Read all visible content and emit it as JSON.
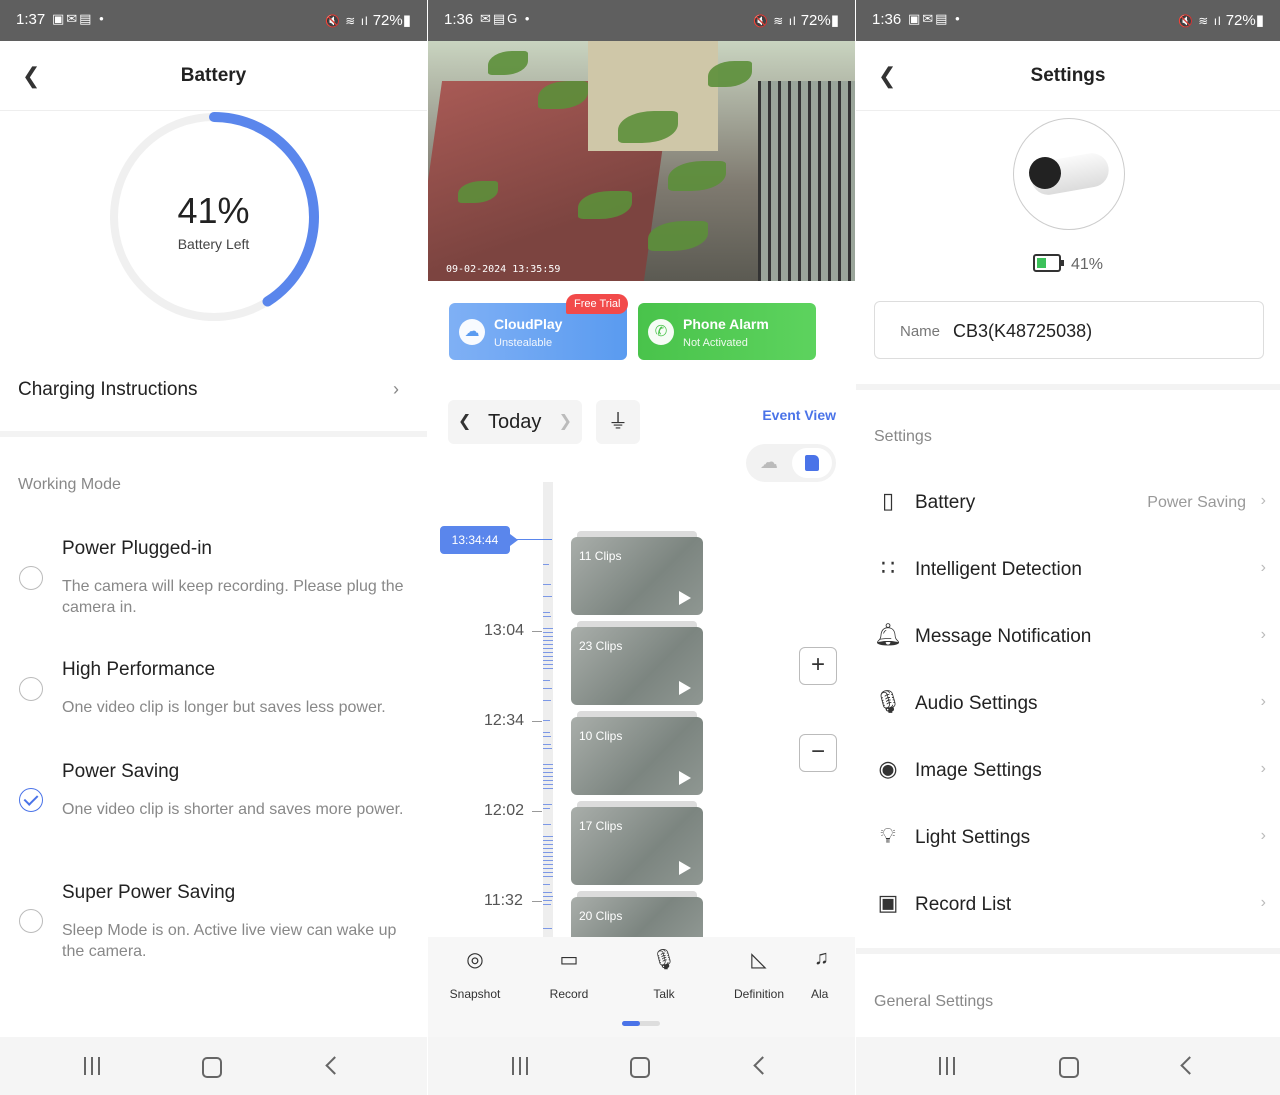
{
  "panel1": {
    "status": {
      "time": "1:37",
      "battery": "72%"
    },
    "title": "Battery",
    "gauge": {
      "percent_text": "41%",
      "sub": "Battery Left",
      "level": 0.41
    },
    "charging_label": "Charging Instructions",
    "working_mode_label": "Working Mode",
    "modes": [
      {
        "title": "Power Plugged-in",
        "desc": "The camera will keep recording. Please plug the camera in.",
        "checked": false
      },
      {
        "title": "High Performance",
        "desc": "One video clip is longer but saves less power.",
        "checked": false
      },
      {
        "title": "Power Saving",
        "desc": "One video clip is shorter and saves more power.",
        "checked": true
      },
      {
        "title": "Super Power Saving",
        "desc": "Sleep Mode is on. Active live view can wake up the camera.",
        "checked": false
      }
    ]
  },
  "panel2": {
    "status": {
      "time": "1:36",
      "battery": "72%"
    },
    "video_timestamp": "09-02-2024 13:35:59",
    "cloudplay": {
      "title": "CloudPlay",
      "sub": "Unstealable",
      "badge": "Free Trial"
    },
    "phone_alarm": {
      "title": "Phone Alarm",
      "sub": "Not Activated"
    },
    "day_label": "Today",
    "event_view": "Event View",
    "current_time": "13:34:44",
    "time_labels": [
      "13:04",
      "12:34",
      "12:02",
      "11:32"
    ],
    "clips": [
      "11 Clips",
      "23 Clips",
      "10 Clips",
      "17 Clips",
      "20 Clips"
    ],
    "tools": [
      "Snapshot",
      "Record",
      "Talk",
      "Definition",
      "Ala"
    ]
  },
  "panel3": {
    "status": {
      "time": "1:36",
      "battery": "72%"
    },
    "title": "Settings",
    "battery_percent": "41%",
    "name_label": "Name",
    "name_value": "CB3(K48725038)",
    "settings_label": "Settings",
    "rows": [
      {
        "label": "Battery",
        "value": "Power Saving",
        "icon": "battery-doc-icon"
      },
      {
        "label": "Intelligent Detection",
        "value": "",
        "icon": "grid-circles-icon"
      },
      {
        "label": "Message Notification",
        "value": "",
        "icon": "bell-icon"
      },
      {
        "label": "Audio Settings",
        "value": "",
        "icon": "microphone-icon"
      },
      {
        "label": "Image Settings",
        "value": "",
        "icon": "image-icon"
      },
      {
        "label": "Light Settings",
        "value": "",
        "icon": "lightbulb-icon"
      },
      {
        "label": "Record List",
        "value": "",
        "icon": "sdcard-icon"
      }
    ],
    "general_label": "General Settings"
  },
  "colors": {
    "accent": "#4a73e8",
    "gauge": "#5a86ec",
    "cloud": "#5a9bf0",
    "alarm": "#49c34b",
    "badge": "#f24a4a"
  }
}
